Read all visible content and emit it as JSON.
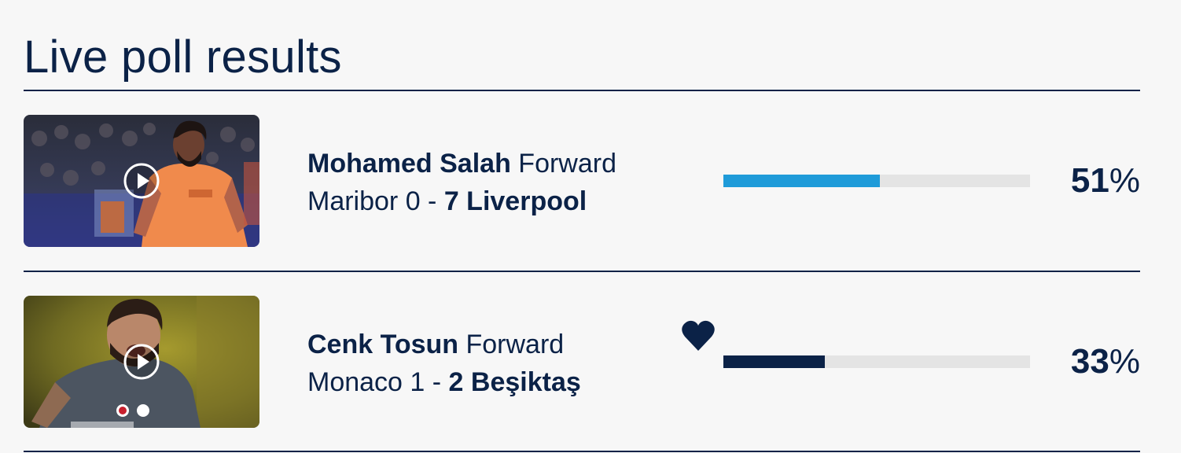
{
  "poll": {
    "title": "Live poll results",
    "percent_symbol": "%",
    "results": [
      {
        "name": "Mohamed Salah",
        "position": "Forward",
        "match_home": "Maribor 0 -",
        "match_winner": "7 Liverpool",
        "percent": "51",
        "fill_fraction": 0.51,
        "bar_color": "#1f9bd9",
        "favorite": false,
        "thumbnail": "video-thumbnail",
        "play_icon": "play-icon"
      },
      {
        "name": "Cenk Tosun",
        "position": "Forward",
        "match_home": "Monaco 1 -",
        "match_winner": "2 Beşiktaş",
        "percent": "33",
        "fill_fraction": 0.33,
        "bar_color": "#0b2247",
        "favorite": true,
        "favorite_icon": "heart-icon",
        "thumbnail": "video-thumbnail",
        "play_icon": "play-icon"
      }
    ]
  },
  "colors": {
    "navy": "#0b2247",
    "accent_blue": "#1f9bd9",
    "track": "#e4e4e4",
    "background": "#f7f7f7"
  }
}
